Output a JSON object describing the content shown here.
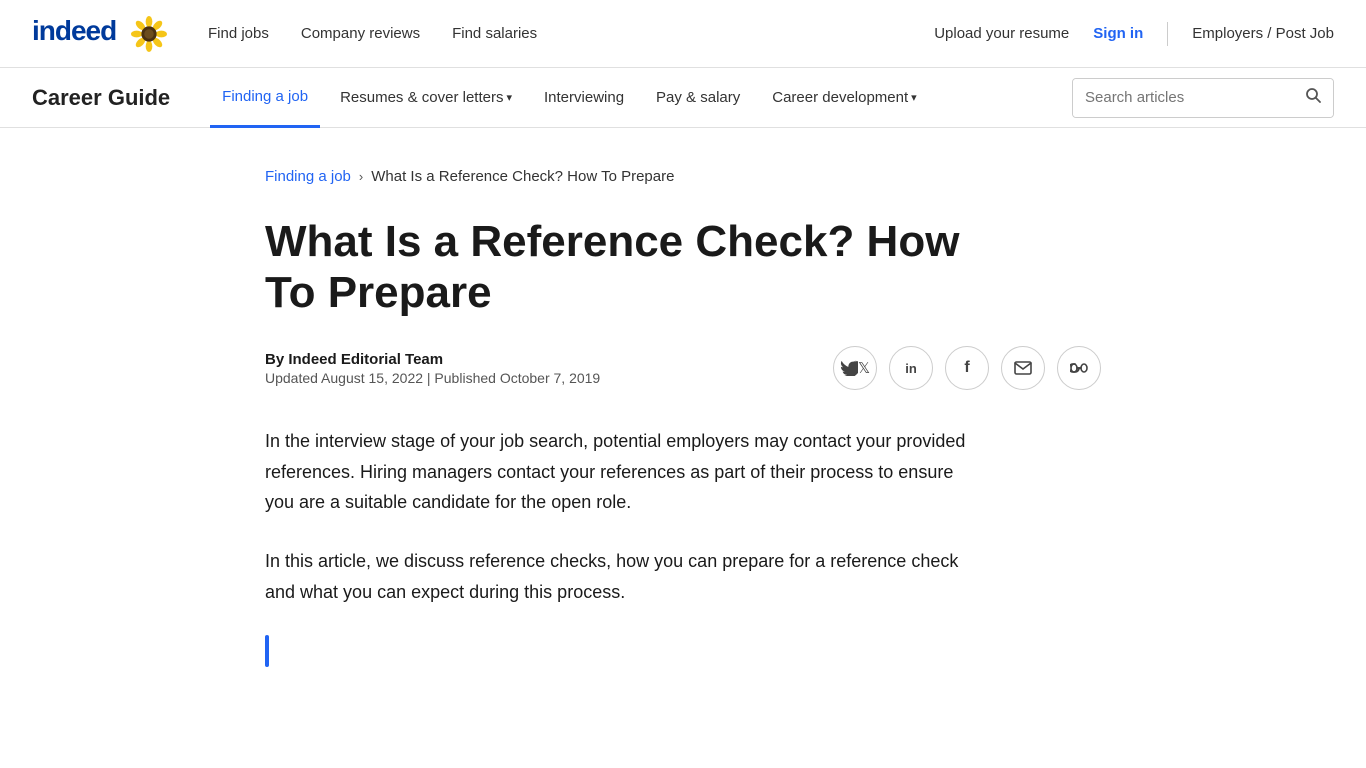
{
  "top_nav": {
    "logo_text": "indeed",
    "nav_links": [
      {
        "label": "Find jobs",
        "href": "#"
      },
      {
        "label": "Company reviews",
        "href": "#"
      },
      {
        "label": "Find salaries",
        "href": "#"
      }
    ],
    "right_links": [
      {
        "label": "Upload your resume",
        "href": "#"
      },
      {
        "label": "Sign in",
        "href": "#",
        "class": "sign-in"
      },
      {
        "label": "Employers / Post Job",
        "href": "#"
      }
    ]
  },
  "career_nav": {
    "title": "Career Guide",
    "links": [
      {
        "label": "Finding a job",
        "href": "#",
        "active": true
      },
      {
        "label": "Resumes & cover letters",
        "href": "#",
        "dropdown": true
      },
      {
        "label": "Interviewing",
        "href": "#"
      },
      {
        "label": "Pay & salary",
        "href": "#"
      },
      {
        "label": "Career development",
        "href": "#",
        "dropdown": true
      }
    ],
    "search_placeholder": "Search articles"
  },
  "breadcrumb": {
    "parent_label": "Finding a job",
    "parent_href": "#",
    "separator": "›",
    "current": "What Is a Reference Check? How To Prepare"
  },
  "article": {
    "title": "What Is a Reference Check? How To Prepare",
    "author": "By Indeed Editorial Team",
    "date": "Updated August 15, 2022 | Published October 7, 2019",
    "body_paragraph_1": "In the interview stage of your job search, potential employers may contact your provided references. Hiring managers contact your references as part of their process to ensure you are a suitable candidate for the open role.",
    "body_paragraph_2": "In this article, we discuss reference checks, how you can prepare for a reference check and what you can expect during this process."
  },
  "share": {
    "twitter_icon": "🐦",
    "linkedin_icon": "in",
    "facebook_icon": "f",
    "email_icon": "✉",
    "link_icon": "🔗"
  }
}
